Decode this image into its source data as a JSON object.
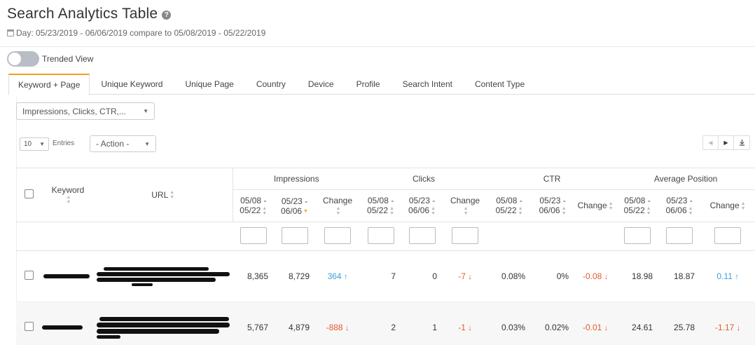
{
  "header": {
    "title": "Search Analytics Table",
    "help_icon": "question-circle-icon",
    "date_range": "Day: 05/23/2019 - 06/06/2019 compare to 05/08/2019 - 05/22/2019"
  },
  "trended_view": {
    "label": "Trended View",
    "enabled": false
  },
  "tabs": [
    {
      "label": "Keyword + Page",
      "active": true
    },
    {
      "label": "Unique Keyword",
      "active": false
    },
    {
      "label": "Unique Page",
      "active": false
    },
    {
      "label": "Country",
      "active": false
    },
    {
      "label": "Device",
      "active": false
    },
    {
      "label": "Profile",
      "active": false
    },
    {
      "label": "Search Intent",
      "active": false
    },
    {
      "label": "Content Type",
      "active": false
    }
  ],
  "metrics_select": {
    "value": "Impressions, Clicks, CTR,..."
  },
  "entries": {
    "value": "10",
    "label": "Entries"
  },
  "action_select": {
    "value": "- Action -"
  },
  "table": {
    "columns": {
      "keyword": "Keyword",
      "url": "URL",
      "groups": [
        "Impressions",
        "Clicks",
        "CTR",
        "Average Position"
      ],
      "prev": "05/08 - 05/22",
      "curr": "05/23 - 06/06",
      "change": "Change"
    },
    "rows": [
      {
        "impressions_prev": "8,365",
        "impressions_curr": "8,729",
        "impressions_change": "364",
        "impressions_dir": "up",
        "clicks_prev": "7",
        "clicks_curr": "0",
        "clicks_change": "-7",
        "clicks_dir": "down",
        "ctr_prev": "0.08%",
        "ctr_curr": "0%",
        "ctr_change": "-0.08",
        "ctr_dir": "down",
        "pos_prev": "18.98",
        "pos_curr": "18.87",
        "pos_change": "0.11",
        "pos_dir": "up"
      },
      {
        "impressions_prev": "5,767",
        "impressions_curr": "4,879",
        "impressions_change": "-888",
        "impressions_dir": "down",
        "clicks_prev": "2",
        "clicks_curr": "1",
        "clicks_change": "-1",
        "clicks_dir": "down",
        "ctr_prev": "0.03%",
        "ctr_curr": "0.02%",
        "ctr_change": "-0.01",
        "ctr_dir": "down",
        "pos_prev": "24.61",
        "pos_curr": "25.78",
        "pos_change": "-1.17",
        "pos_dir": "down"
      }
    ]
  },
  "colors": {
    "accent": "#f0a020",
    "positive": "#3aa0d8",
    "negative": "#e25b2a"
  }
}
